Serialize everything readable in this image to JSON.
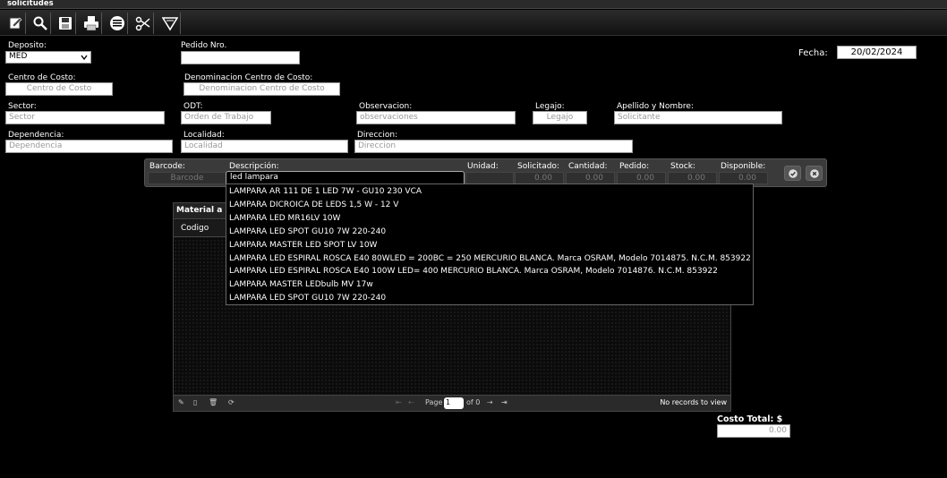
{
  "window": {
    "title": "solicitudes"
  },
  "toolbar": {
    "buttons": [
      {
        "icon": "edit-icon"
      },
      {
        "icon": "search-icon"
      },
      {
        "icon": "save-icon"
      },
      {
        "icon": "print-icon"
      },
      {
        "icon": "list-icon"
      },
      {
        "icon": "cut-icon"
      },
      {
        "icon": "filter-icon"
      }
    ]
  },
  "form": {
    "deposito": {
      "label": "Deposito:",
      "value": "MED"
    },
    "pedido": {
      "label": "Pedido Nro.",
      "value": ""
    },
    "fecha": {
      "label": "Fecha:",
      "value": "20/02/2024"
    },
    "centro_costo": {
      "label": "Centro de Costo:",
      "placeholder": "Centro de Costo"
    },
    "denominacion": {
      "label": "Denominacion Centro de Costo:",
      "placeholder": "Denominacion Centro de Costo"
    },
    "sector": {
      "label": "Sector:",
      "placeholder": "Sector"
    },
    "odt": {
      "label": "ODT:",
      "placeholder": "Orden de Trabajo"
    },
    "observacion": {
      "label": "Observacion:",
      "placeholder": "observaciones"
    },
    "legajo": {
      "label": "Legajo:",
      "placeholder": "Legajo"
    },
    "apellido": {
      "label": "Apellido y Nombre:",
      "placeholder": "Solicitante"
    },
    "dependencia": {
      "label": "Dependencia:",
      "placeholder": "Dependencia"
    },
    "localidad": {
      "label": "Localidad:",
      "placeholder": "Localidad"
    },
    "direccion": {
      "label": "Direccion:",
      "placeholder": "Direccion"
    }
  },
  "itembar": {
    "barcode": {
      "label": "Barcode:",
      "placeholder": "Barcode"
    },
    "descripcion": {
      "label": "Descripción:",
      "value": "led lampara"
    },
    "unidad": {
      "label": "Unidad:"
    },
    "solicitado": {
      "label": "Solicitado:",
      "value": "0.00"
    },
    "cantidad": {
      "label": "Cantidad:",
      "value": "0.00"
    },
    "pedido": {
      "label": "Pedido:",
      "value": "0.00"
    },
    "stock": {
      "label": "Stock:",
      "value": "0.00"
    },
    "disponible": {
      "label": "Disponible:",
      "value": "0.00"
    }
  },
  "autocomplete": [
    "LAMPARA AR 111 DE 1 LED 7W - GU10 230 VCA",
    "LAMPARA DICROICA DE LEDS 1,5 W - 12 V",
    "LAMPARA LED MR16LV 10W",
    "LAMPARA LED SPOT GU10 7W 220-240",
    "LAMPARA MASTER LED SPOT LV 10W",
    "LAMPARA LED ESPIRAL ROSCA E40 80WLED = 200BC = 250 MERCURIO BLANCA. Marca OSRAM, Modelo 7014875. N.C.M. 853922",
    "LAMPARA LED ESPIRAL ROSCA E40 100W LED= 400 MERCURIO BLANCA. Marca OSRAM, Modelo 7014876. N.C.M. 853922",
    "LAMPARA MASTER LEDbulb MV 17w",
    "LAMPARA LED SPOT GU10 7W 220-240"
  ],
  "grid": {
    "caption": "Material a D",
    "columns": [
      "Codigo"
    ],
    "pager": {
      "page_label": "Page",
      "page_value": "1",
      "of_label": "of 0",
      "records": "No records to view"
    }
  },
  "total": {
    "label": "Costo Total: $",
    "value": "0.00"
  }
}
